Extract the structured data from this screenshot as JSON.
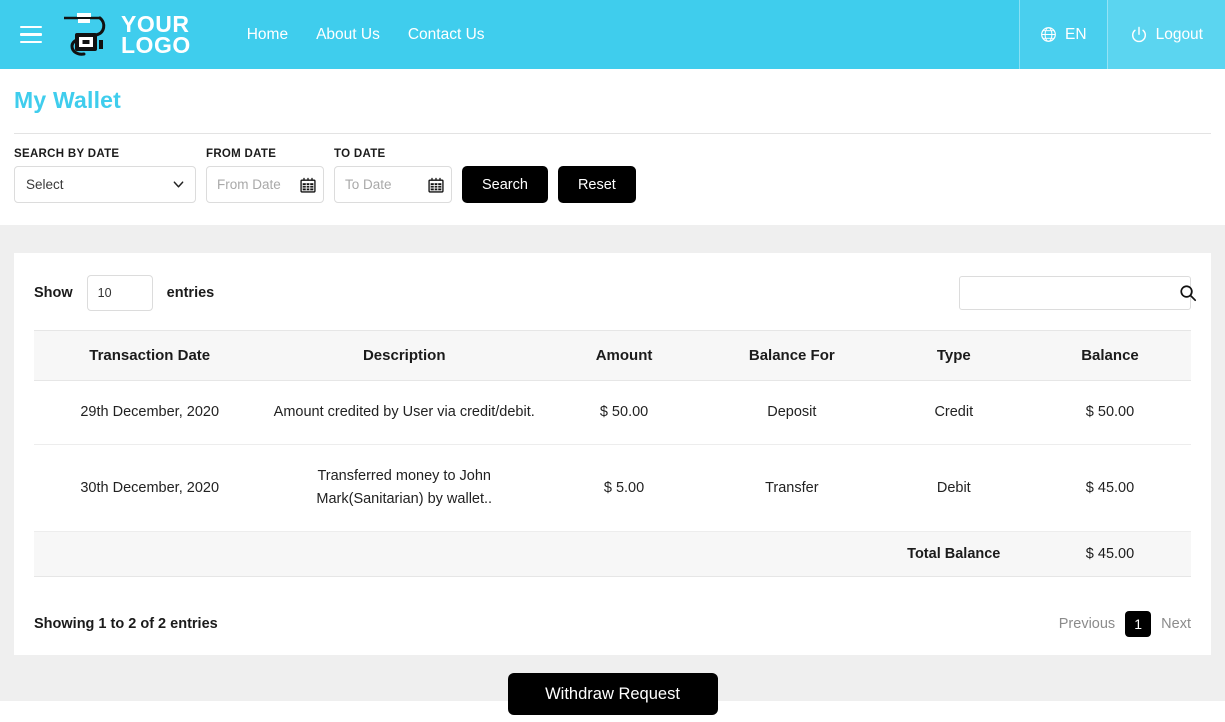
{
  "header": {
    "menu_icon": "hamburger-menu-icon",
    "logo": {
      "icon": "camera-swirl-logo-icon",
      "line1": "YOUR",
      "line2": "LOGO"
    },
    "nav": [
      {
        "label": "Home"
      },
      {
        "label": "About Us"
      },
      {
        "label": "Contact Us"
      }
    ],
    "language": {
      "icon": "globe-icon",
      "label": "EN"
    },
    "logout": {
      "icon": "power-icon",
      "label": "Logout"
    },
    "background_color": "#3FCDED"
  },
  "page": {
    "title": "My Wallet",
    "title_color": "#3FCDED"
  },
  "search_form": {
    "search_by_date_label": "SEARCH BY DATE",
    "select_value": "Select",
    "from_date_label": "FROM DATE",
    "from_date_placeholder": "From Date",
    "from_date_value": "",
    "to_date_label": "TO DATE",
    "to_date_placeholder": "To Date",
    "to_date_value": "",
    "search_button": "Search",
    "reset_button": "Reset"
  },
  "table_controls": {
    "show_label": "Show",
    "entries_value": "10",
    "entries_label": "entries",
    "search_value": "",
    "search_placeholder": ""
  },
  "table": {
    "columns": [
      "Transaction Date",
      "Description",
      "Amount",
      "Balance For",
      "Type",
      "Balance"
    ],
    "rows": [
      {
        "date": "29th December, 2020",
        "description": "Amount credited by User via credit/debit.",
        "amount": "$ 50.00",
        "balance_for": "Deposit",
        "type": "Credit",
        "balance": "$ 50.00"
      },
      {
        "date": "30th December, 2020",
        "description": "Transferred money to John Mark(Sanitarian) by wallet..",
        "amount": "$ 5.00",
        "balance_for": "Transfer",
        "type": "Debit",
        "balance": "$ 45.00"
      }
    ],
    "total_label": "Total Balance",
    "total_value": "$ 45.00"
  },
  "footer": {
    "showing_text": "Showing 1 to 2 of 2 entries",
    "previous_label": "Previous",
    "current_page": "1",
    "next_label": "Next"
  },
  "actions": {
    "withdraw_label": "Withdraw Request"
  }
}
